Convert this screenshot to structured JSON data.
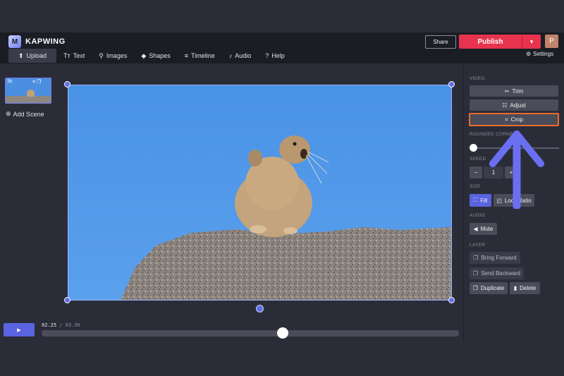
{
  "app": {
    "logo_text": "KAPWING",
    "logo_glyph": "M"
  },
  "header": {
    "tabs": [
      {
        "label": "Upload",
        "icon": "upload-icon",
        "glyph": "⬆"
      },
      {
        "label": "Text",
        "icon": "text-icon",
        "glyph": "Tт"
      },
      {
        "label": "Images",
        "icon": "search-icon",
        "glyph": "⚲"
      },
      {
        "label": "Shapes",
        "icon": "shapes-icon",
        "glyph": "◆"
      },
      {
        "label": "Timeline",
        "icon": "timeline-icon",
        "glyph": "≡"
      },
      {
        "label": "Audio",
        "icon": "music-note-icon",
        "glyph": "♪"
      },
      {
        "label": "Help",
        "icon": "help-icon",
        "glyph": "?"
      }
    ],
    "share_label": "Share",
    "publish_label": "Publish",
    "avatar_initial": "P",
    "settings_label": "Settings"
  },
  "scenes": {
    "items": [
      {
        "duration": "3s"
      }
    ],
    "add_label": "Add Scene"
  },
  "right_panel": {
    "video_label": "VIDEO",
    "trim_label": "Trim",
    "adjust_label": "Adjust",
    "crop_label": "Crop",
    "rounded_corners_label": "ROUNDED CORNERS",
    "rounded_corners_value": 0,
    "speed_label": "SPEED",
    "speed_minus": "−",
    "speed_value": "1",
    "speed_plus": "+",
    "size_label": "SIZE",
    "fill_label": "Fill",
    "lock_ratio_label": "Lock Ratio",
    "audio_label": "AUDIO",
    "mute_label": "Mute",
    "layer_label": "LAYER",
    "bring_forward_label": "Bring Forward",
    "send_backward_label": "Send Backward",
    "duplicate_label": "Duplicate",
    "delete_label": "Delete"
  },
  "playback": {
    "current_time": "02.25",
    "separator": "/",
    "total_time": "03.90",
    "progress": 0.577
  },
  "colors": {
    "accent": "#5a63e0",
    "publish": "#e8334e",
    "highlight": "#ee6b2f",
    "arrow": "#6a6ff2"
  }
}
